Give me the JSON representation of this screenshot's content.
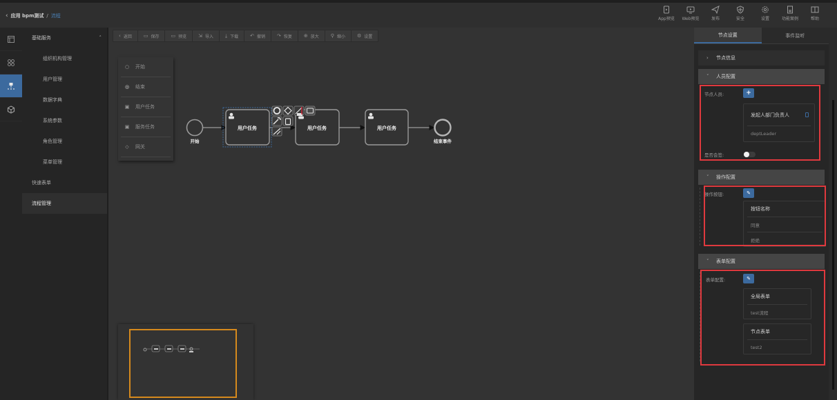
{
  "header": {
    "back_icon": "chevron-left-icon",
    "app_name": "应用 bpm测试",
    "separator": "/",
    "current": "流程",
    "actions": [
      {
        "label": "App预览",
        "icon": "mobile-preview-icon"
      },
      {
        "label": "Web预览",
        "icon": "monitor-preview-icon"
      },
      {
        "label": "发布",
        "icon": "paper-plane-icon"
      },
      {
        "label": "安全",
        "icon": "shield-icon"
      },
      {
        "label": "设置",
        "icon": "gear-icon"
      },
      {
        "label": "功能案例",
        "icon": "document-icon"
      },
      {
        "label": "帮助",
        "icon": "book-icon"
      }
    ]
  },
  "rail": {
    "items": [
      {
        "icon": "layout-icon",
        "active": false
      },
      {
        "icon": "grid-icon",
        "active": false
      },
      {
        "icon": "flow-icon",
        "active": true
      },
      {
        "icon": "cube-icon",
        "active": false
      }
    ]
  },
  "menu": {
    "group": {
      "label": "基础服务",
      "expanded": true,
      "icon": "chevron-up-icon"
    },
    "children": [
      "组织机构管理",
      "用户管理",
      "数据字典",
      "系统参数",
      "角色管理",
      "菜单管理"
    ],
    "top_items": [
      "快速表单",
      "流程管理"
    ],
    "active": "流程管理"
  },
  "toolbar": {
    "buttons": [
      {
        "label": "返回",
        "icon": "‹"
      },
      {
        "label": "保存",
        "icon": "▭"
      },
      {
        "label": "预览",
        "icon": "▭"
      },
      {
        "label": "导入",
        "icon": "⇲"
      },
      {
        "label": "下载",
        "icon": "⤓"
      },
      {
        "label": "撤销",
        "icon": "↶"
      },
      {
        "label": "恢复",
        "icon": "↷"
      },
      {
        "label": "放大",
        "icon": "⊕"
      },
      {
        "label": "缩小",
        "icon": "⚲"
      },
      {
        "label": "设置",
        "icon": "⚙"
      }
    ]
  },
  "palette": {
    "items": [
      {
        "label": "开始",
        "icon": "○"
      },
      {
        "label": "结束",
        "icon": "◎"
      },
      {
        "label": "用户任务",
        "icon": "▣"
      },
      {
        "label": "服务任务",
        "icon": "▣"
      },
      {
        "label": "网关",
        "icon": "◇"
      }
    ]
  },
  "diagram": {
    "start_label": "开始",
    "end_label": "结束事件",
    "tasks": [
      "用户任务",
      "用户任务",
      "用户任务"
    ],
    "selected_task_index": 0,
    "context_pad": [
      "end-event-icon",
      "gateway-icon",
      "text-annotation-icon",
      "task-icon",
      "wrench-icon",
      "trash-icon",
      "connect-icon"
    ]
  },
  "right_panel": {
    "tabs": [
      {
        "label": "节点设置",
        "active": true
      },
      {
        "label": "事件监听",
        "active": false
      }
    ],
    "sections": {
      "node_info": {
        "title": "节点信息",
        "expanded": false
      },
      "people": {
        "title": "人员配置",
        "expanded": true,
        "node_people_label": "节点人员:",
        "add_label": "+",
        "card_title": "发起人部门负责人",
        "card_value": "deptLeader",
        "countersign_label": "是否会签:",
        "countersign_on": false
      },
      "operations": {
        "title": "操作配置",
        "expanded": true,
        "buttons_label": "操作按钮:",
        "edit_icon": "edit-icon",
        "header": "按钮名称",
        "rows": [
          "同意",
          "拒绝"
        ]
      },
      "forms": {
        "title": "表单配置",
        "expanded": true,
        "label": "表单配置:",
        "edit_icon": "edit-icon",
        "cards": [
          {
            "title": "全局表单",
            "value": "test流程"
          },
          {
            "title": "节点表单",
            "value": "test2"
          }
        ]
      }
    }
  },
  "colors": {
    "accent": "#3c6a9e",
    "highlight_box": "#e0393e",
    "minimap_frame": "#d78a1d"
  }
}
